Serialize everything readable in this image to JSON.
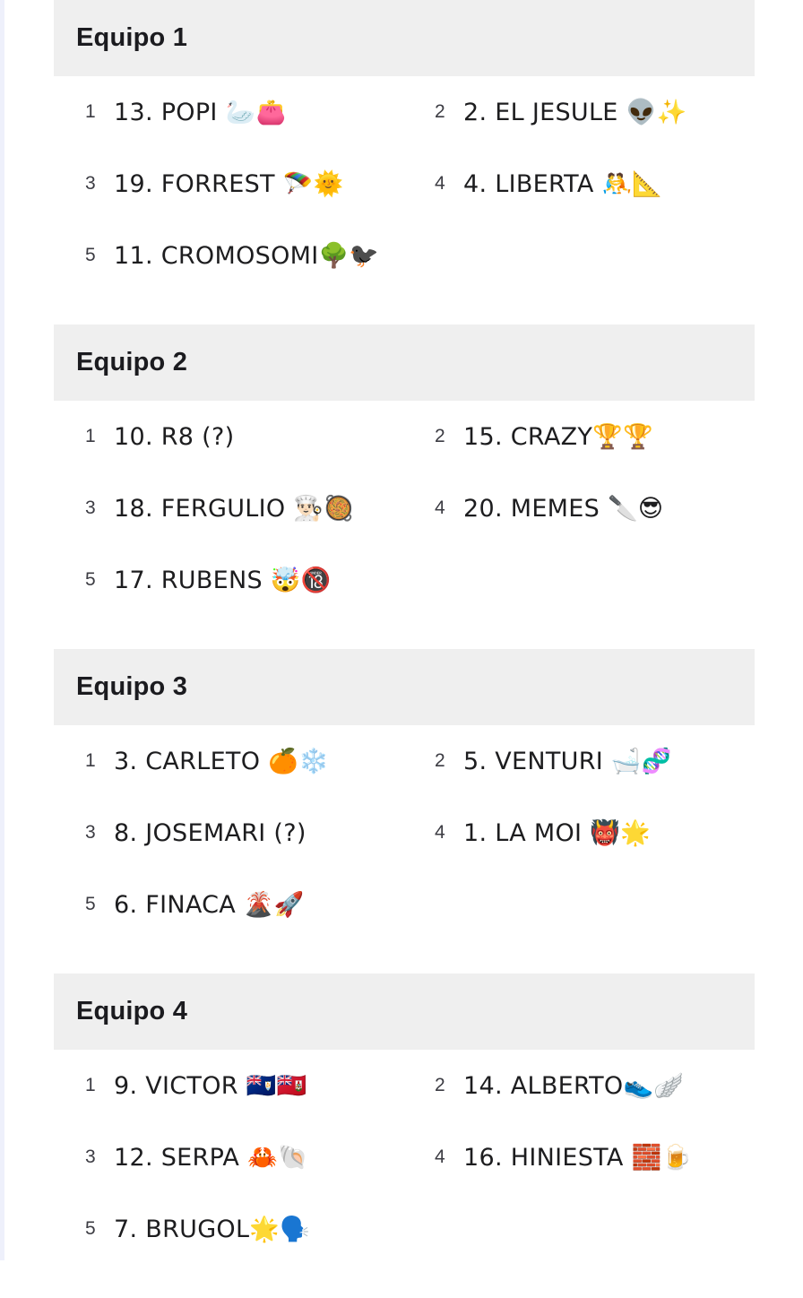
{
  "teams": [
    {
      "title": "Equipo 1",
      "players": [
        {
          "num": "1",
          "name": "13. POPI 🦢👛"
        },
        {
          "num": "2",
          "name": "2. EL JESULE 👽✨"
        },
        {
          "num": "3",
          "name": "19. FORREST 🪂🌞"
        },
        {
          "num": "4",
          "name": "4. LIBERTA 🤼📐"
        },
        {
          "num": "5",
          "name": "11. CROMOSOMI🌳🐦‍⬛"
        }
      ]
    },
    {
      "title": "Equipo 2",
      "players": [
        {
          "num": "1",
          "name": "10. R8 (?)"
        },
        {
          "num": "2",
          "name": "15. CRAZY🏆🏆"
        },
        {
          "num": "3",
          "name": "18. FERGULIO 👨🏻‍🍳🥘"
        },
        {
          "num": "4",
          "name": "20. MEMES 🔪😎"
        },
        {
          "num": "5",
          "name": "17. RUBENS 🤯🔞"
        }
      ]
    },
    {
      "title": "Equipo 3",
      "players": [
        {
          "num": "1",
          "name": "3. CARLETO 🍊❄️"
        },
        {
          "num": "2",
          "name": "5. VENTURI 🛁🧬"
        },
        {
          "num": "3",
          "name": "8. JOSEMARI (?)"
        },
        {
          "num": "4",
          "name": "1. LA MOI 👹🌟"
        },
        {
          "num": "5",
          "name": "6. FINACA 🌋🚀"
        }
      ]
    },
    {
      "title": "Equipo 4",
      "players": [
        {
          "num": "1",
          "name": "9. VICTOR 🇦🇮🇧🇲"
        },
        {
          "num": "2",
          "name": "14. ALBERTO👟🪽"
        },
        {
          "num": "3",
          "name": "12. SERPA 🦀🐚"
        },
        {
          "num": "4",
          "name": "16. HINIESTA 🧱🍺"
        },
        {
          "num": "5",
          "name": "7. BRUGOL🌟🗣️"
        }
      ]
    }
  ]
}
